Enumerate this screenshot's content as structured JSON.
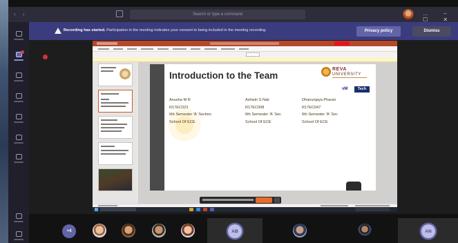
{
  "titlebar": {
    "nav": "‹ ›",
    "search_placeholder": "Search or type a command",
    "window_controls": "… – ☐ ✕"
  },
  "banner": {
    "title": "Recording has started.",
    "text": "Participation in the meeting indicates your consent to being included in the meeting recording.",
    "privacy_label": "Privacy policy",
    "dismiss_label": "Dismiss"
  },
  "slide": {
    "title": "Introduction to the Team",
    "logo_name": "REVA",
    "logo_sub": "UNIVERSITY",
    "logo_vm": "vM",
    "logo_badge": "Tech",
    "members": [
      {
        "name": "Anusha M R",
        "srn": "R17EC023",
        "sem": "6th Semester 'A' Section",
        "school": "School Of ECE"
      },
      {
        "name": "Ashwin S Nair",
        "srn": "R17EC008",
        "sem": "6th Semester 'A' Sec",
        "school": "School Of ECE"
      },
      {
        "name": "Dhanunjaya Pharan",
        "srn": "R17EC047",
        "sem": "6th Semester 'A' Sec",
        "school": "School Of ECE"
      }
    ]
  },
  "participants": {
    "more_label": "+4",
    "initials": [
      "AB",
      "AN"
    ]
  },
  "colors": {
    "accent": "#6264a7",
    "banner": "#3b3c7e",
    "powerpoint": "#b7472a",
    "recording": "#d13438"
  },
  "icons": [
    "edit-icon",
    "warning-icon",
    "recording-icon",
    "rail-activity-icon",
    "rail-chat-icon",
    "rail-teams-icon",
    "rail-calendar-icon",
    "rail-calls-icon",
    "rail-files-icon",
    "rail-apps-icon",
    "rail-help-icon"
  ]
}
